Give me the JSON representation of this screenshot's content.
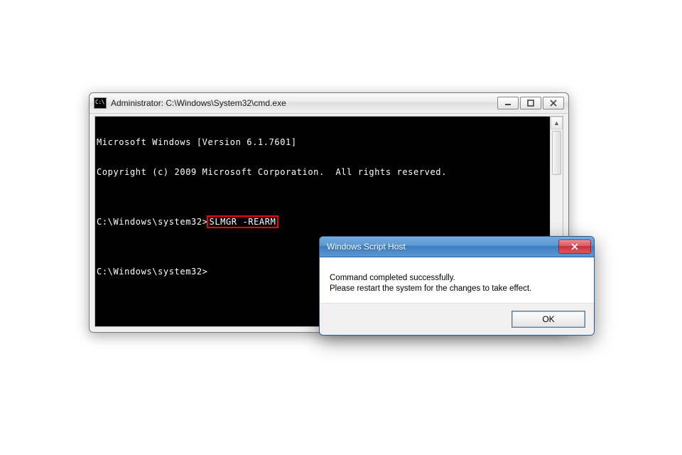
{
  "cmd": {
    "title": "Administrator: C:\\Windows\\System32\\cmd.exe",
    "lines": {
      "version": "Microsoft Windows [Version 6.1.7601]",
      "copyright": "Copyright (c) 2009 Microsoft Corporation.  All rights reserved.",
      "blank1": "",
      "prompt1_prefix": "C:\\Windows\\system32>",
      "prompt1_command": "SLMGR -REARM",
      "blank2": "",
      "prompt2": "C:\\Windows\\system32>"
    }
  },
  "dialog": {
    "title": "Windows Script Host",
    "message_line1": "Command completed successfully.",
    "message_line2": "Please restart the system for the changes to take effect.",
    "ok_label": "OK"
  }
}
